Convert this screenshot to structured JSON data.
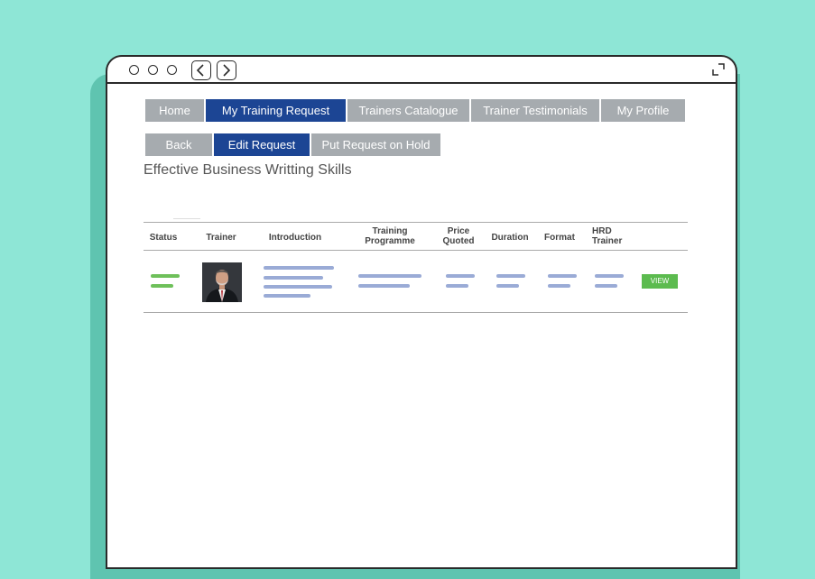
{
  "nav": {
    "tabs": [
      {
        "label": "Home"
      },
      {
        "label": "My Training Request"
      },
      {
        "label": "Trainers Catalogue"
      },
      {
        "label": "Trainer Testimonials"
      },
      {
        "label": "My Profile"
      }
    ],
    "active_tab": "My Training Request"
  },
  "subnav": {
    "back_label": "Back",
    "edit_label": "Edit Request",
    "hold_label": "Put Request on Hold"
  },
  "page": {
    "title": "Effective Business Writting Skills"
  },
  "table": {
    "columns": [
      {
        "line1": "Status",
        "line2": ""
      },
      {
        "line1": "Trainer",
        "line2": ""
      },
      {
        "line1": "Introduction",
        "line2": ""
      },
      {
        "line1": "Training",
        "line2": "Programme"
      },
      {
        "line1": "Price",
        "line2": "Quoted"
      },
      {
        "line1": "Duration",
        "line2": ""
      },
      {
        "line1": "Format",
        "line2": ""
      },
      {
        "line1": "HRD",
        "line2": "Trainer"
      }
    ],
    "row": {
      "view_label": "VIEW"
    }
  },
  "colors": {
    "background": "#8ee6d6",
    "primary": "#1c4594",
    "tab_gray": "#a6abaf",
    "status_green": "#6ec05a",
    "placeholder_blue": "#9aabd6"
  }
}
